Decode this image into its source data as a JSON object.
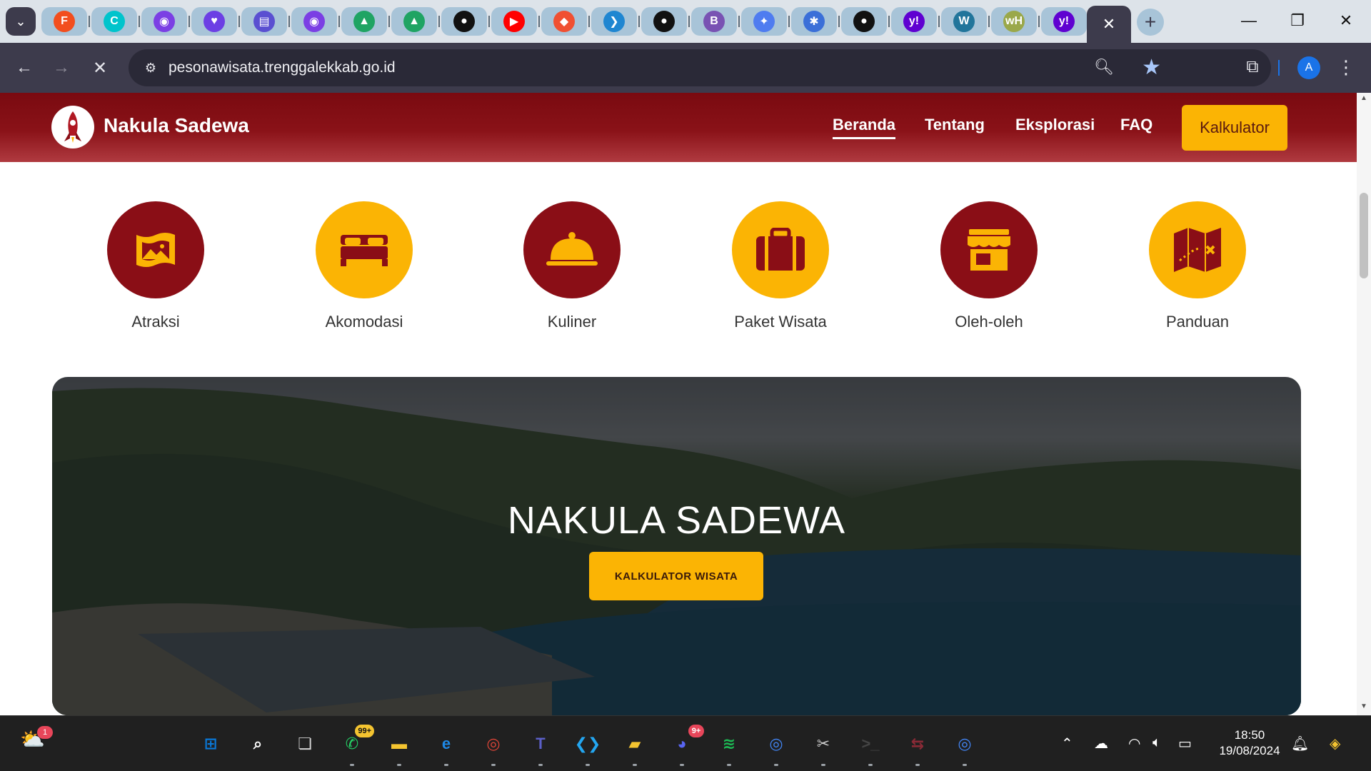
{
  "browser": {
    "tab_menu_icon": "chevron-down-icon",
    "tabs": [
      {
        "icon": "figma-icon",
        "color": "#f24e1e",
        "glyph": "F"
      },
      {
        "icon": "canva-icon",
        "color": "#00c4cc",
        "glyph": "C"
      },
      {
        "icon": "chatbot-icon",
        "color": "#7b3fe4",
        "glyph": "◉"
      },
      {
        "icon": "heart-chat-icon",
        "color": "#6c3fe4",
        "glyph": "♥"
      },
      {
        "icon": "printer-icon",
        "color": "#5a4fd1",
        "glyph": "▤"
      },
      {
        "icon": "chatbot-icon",
        "color": "#7b3fe4",
        "glyph": "◉"
      },
      {
        "icon": "google-drive-icon",
        "color": "#1fa463",
        "glyph": "▲"
      },
      {
        "icon": "google-drive-icon",
        "color": "#1fa463",
        "glyph": "▲"
      },
      {
        "icon": "github-icon",
        "color": "#111111",
        "glyph": "●"
      },
      {
        "icon": "youtube-icon",
        "color": "#ff0000",
        "glyph": "▶"
      },
      {
        "icon": "git-icon",
        "color": "#f05032",
        "glyph": "◆"
      },
      {
        "icon": "flutter-icon",
        "color": "#1f86d1",
        "glyph": "❯"
      },
      {
        "icon": "github-icon",
        "color": "#111111",
        "glyph": "●"
      },
      {
        "icon": "bootstrap-icon",
        "color": "#7952b3",
        "glyph": "B"
      },
      {
        "icon": "gemini-icon",
        "color": "#4f7cf0",
        "glyph": "✦"
      },
      {
        "icon": "sparkle-icon",
        "color": "#3b6fd8",
        "glyph": "✱"
      },
      {
        "icon": "github-icon",
        "color": "#111111",
        "glyph": "●"
      },
      {
        "icon": "yahoo-icon",
        "color": "#5f01d1",
        "glyph": "y!"
      },
      {
        "icon": "wordpress-icon",
        "color": "#21759b",
        "glyph": "W"
      },
      {
        "icon": "webhost-icon",
        "color": "#9aa84a",
        "glyph": "wH"
      },
      {
        "icon": "yahoo-icon",
        "color": "#5f01d1",
        "glyph": "y!"
      }
    ],
    "active_tab_icon": "close-icon",
    "new_tab_icon": "plus-icon",
    "window_controls": [
      "minimize-icon",
      "restore-icon",
      "close-icon"
    ],
    "url": "pesonawisata.trenggalekkab.go.id",
    "profile_initial": "A"
  },
  "site": {
    "brand": "Nakula Sadewa",
    "nav": [
      "Beranda",
      "Tentang",
      "Eksplorasi",
      "FAQ"
    ],
    "nav_cta": "Kalkulator",
    "colors": {
      "primary": "#7a0a10",
      "accent": "#fbb404"
    },
    "categories": [
      {
        "label": "Atraksi",
        "icon": "landscape-icon",
        "color": "#8a0e16"
      },
      {
        "label": "Akomodasi",
        "icon": "bed-icon",
        "color": "#fbb404"
      },
      {
        "label": "Kuliner",
        "icon": "food-cloche-icon",
        "color": "#8a0e16"
      },
      {
        "label": "Paket Wisata",
        "icon": "suitcase-icon",
        "color": "#fbb404"
      },
      {
        "label": "Oleh-oleh",
        "icon": "shop-icon",
        "color": "#8a0e16"
      },
      {
        "label": "Panduan",
        "icon": "map-icon",
        "color": "#fbb404"
      }
    ],
    "hero": {
      "title": "NAKULA SADEWA",
      "button": "KALKULATOR WISATA"
    }
  },
  "taskbar": {
    "weather_badge": "1",
    "apps": [
      {
        "icon": "windows-start-icon"
      },
      {
        "icon": "search-icon"
      },
      {
        "icon": "task-view-icon"
      },
      {
        "icon": "whatsapp-icon",
        "badge": "99+"
      },
      {
        "icon": "file-explorer-icon"
      },
      {
        "icon": "edge-icon"
      },
      {
        "icon": "chrome-icon"
      },
      {
        "icon": "teams-icon"
      },
      {
        "icon": "vscode-icon"
      },
      {
        "icon": "sticky-notes-icon"
      },
      {
        "icon": "discord-icon",
        "badge": "9+"
      },
      {
        "icon": "spotify-icon"
      },
      {
        "icon": "chrome-profile-icon"
      },
      {
        "icon": "snipping-tool-icon"
      },
      {
        "icon": "terminal-icon"
      },
      {
        "icon": "vpn-icon"
      },
      {
        "icon": "chrome-profile-icon"
      }
    ],
    "time": "18:50",
    "date": "19/08/2024"
  }
}
